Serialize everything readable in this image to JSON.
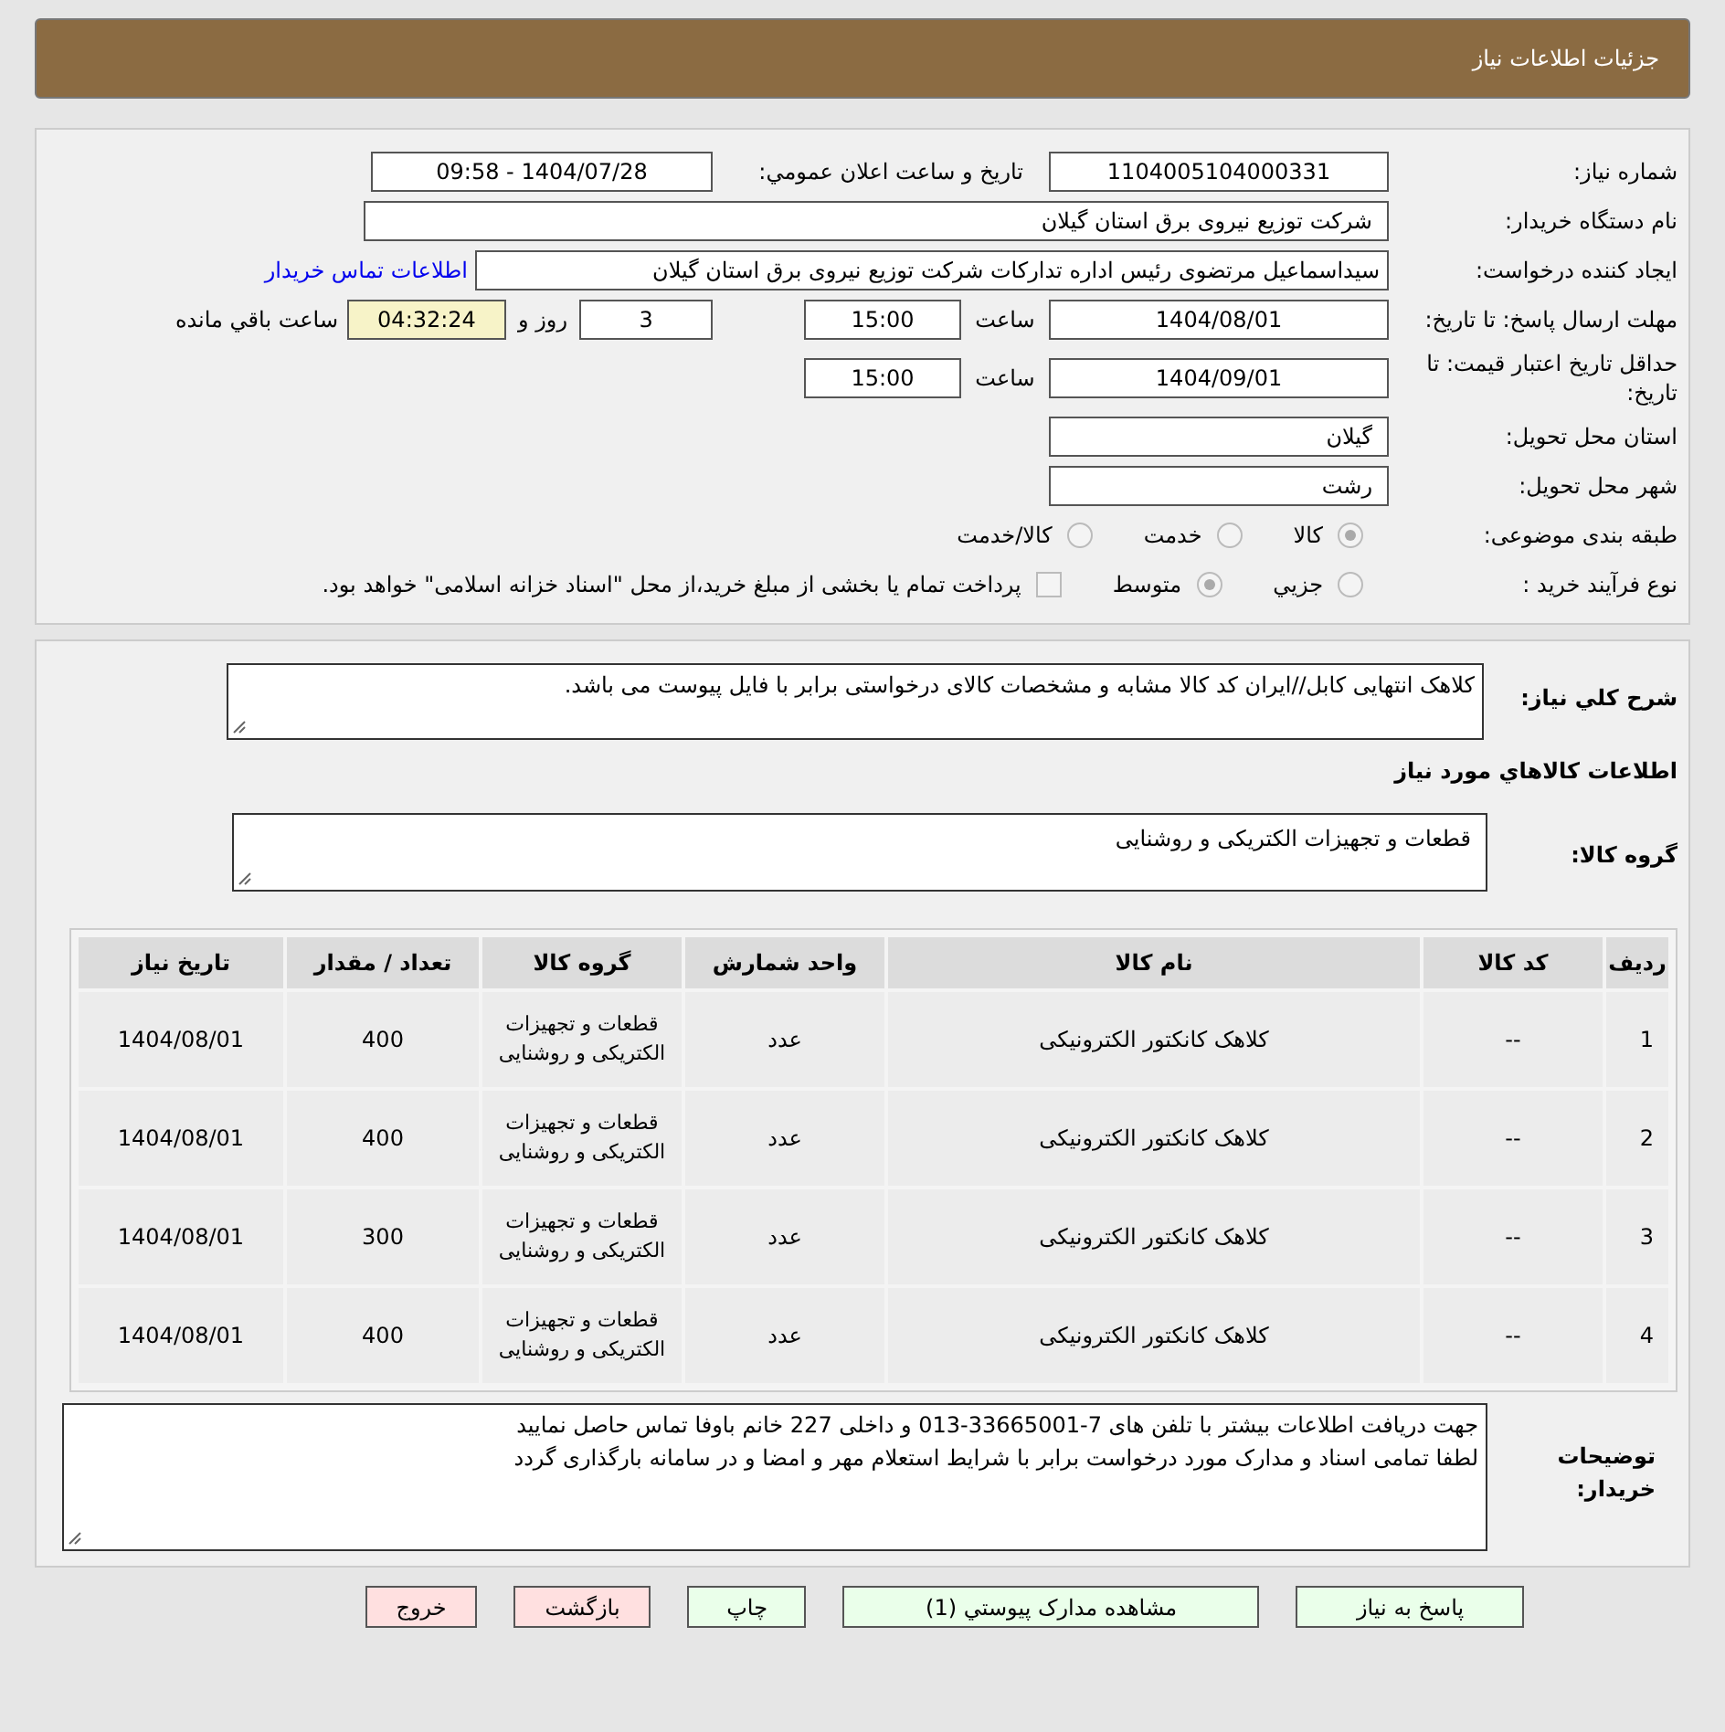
{
  "header": {
    "title": "جزئیات اطلاعات نیاز"
  },
  "need_number": {
    "label": "شماره نیاز:",
    "value": "1104005104000331"
  },
  "announce": {
    "label": "تاریخ و ساعت اعلان عمومي:",
    "value": "1404/07/28 - 09:58"
  },
  "buyer": {
    "label": "نام دستگاه خریدار:",
    "value": "شرکت توزیع نیروی برق استان گیلان"
  },
  "creator": {
    "label": "ایجاد کننده درخواست:",
    "value": "سیداسماعیل مرتضوی رئیس اداره تدارکات شرکت توزیع نیروی برق استان گیلان",
    "link": "اطلاعات تماس خریدار"
  },
  "deadline": {
    "label": "مهلت ارسال پاسخ: تا تاریخ:",
    "date": "1404/08/01",
    "time_label": "ساعت",
    "time": "15:00",
    "days": "3",
    "days_label": "روز و",
    "remaining": "04:32:24",
    "remaining_label": "ساعت باقي مانده"
  },
  "validity": {
    "label": "حداقل تاریخ اعتبار قیمت: تا تاریخ:",
    "date": "1404/09/01",
    "time_label": "ساعت",
    "time": "15:00"
  },
  "province": {
    "label": "استان محل تحویل:",
    "value": "گیلان"
  },
  "city": {
    "label": "شهر محل تحویل:",
    "value": "رشت"
  },
  "category": {
    "label": "طبقه بندی موضوعی:",
    "options": [
      {
        "label": "کالا",
        "selected": true
      },
      {
        "label": "خدمت",
        "selected": false
      },
      {
        "label": "کالا/خدمت",
        "selected": false
      }
    ]
  },
  "purchase_type": {
    "label": "نوع فرآیند خرید :",
    "options": [
      {
        "label": "جزيي",
        "selected": false
      },
      {
        "label": "متوسط",
        "selected": true
      }
    ],
    "payment": {
      "checked": false,
      "label": "پرداخت تمام یا بخشی از مبلغ خرید،از محل \"اسناد خزانه اسلامی\" خواهد بود."
    }
  },
  "description": {
    "label": "شرح کلي نیاز:",
    "value": "کلاهک انتهایی کابل//ایران کد کالا مشابه و مشخصات کالای درخواستی برابر با فایل پیوست می باشد."
  },
  "goods_title": "اطلاعات کالاهاي مورد نیاز",
  "goods_group": {
    "label": "گروه کالا:",
    "value": "قطعات و تجهیزات الکتریکی و روشنایی"
  },
  "table": {
    "columns": [
      "ردیف",
      "کد کالا",
      "نام کالا",
      "واحد شمارش",
      "گروه کالا",
      "تعداد / مقدار",
      "تاریخ نیاز"
    ],
    "rows": [
      [
        "1",
        "--",
        "کلاهک کانکتور الکترونیکی",
        "عدد",
        "قطعات و تجهیزات الکتریکی و روشنایی",
        "400",
        "1404/08/01"
      ],
      [
        "2",
        "--",
        "کلاهک کانکتور الکترونیکی",
        "عدد",
        "قطعات و تجهیزات الکتریکی و روشنایی",
        "400",
        "1404/08/01"
      ],
      [
        "3",
        "--",
        "کلاهک کانکتور الکترونیکی",
        "عدد",
        "قطعات و تجهیزات الکتریکی و روشنایی",
        "300",
        "1404/08/01"
      ],
      [
        "4",
        "--",
        "کلاهک کانکتور الکترونیکی",
        "عدد",
        "قطعات و تجهیزات الکتریکی و روشنایی",
        "400",
        "1404/08/01"
      ]
    ]
  },
  "buyer_notes": {
    "label": "توضیحات خریدار:",
    "lines": [
      "جهت دریافت اطلاعات بیشتر با تلفن های 7-33665001-013 و داخلی 227 خانم باوفا تماس حاصل نمایید",
      "لطفا تمامی اسناد و مدارک مورد درخواست برابر با شرایط استعلام مهر و امضا و در سامانه بارگذاری گردد"
    ]
  },
  "buttons": [
    {
      "label": "پاسخ به نیاز",
      "kind": "action"
    },
    {
      "label": "مشاهده مدارک پیوستي (1)",
      "kind": "action"
    },
    {
      "label": "چاپ",
      "kind": "action"
    },
    {
      "label": "بازگشت",
      "kind": "exit"
    },
    {
      "label": "خروج",
      "kind": "exit"
    }
  ]
}
